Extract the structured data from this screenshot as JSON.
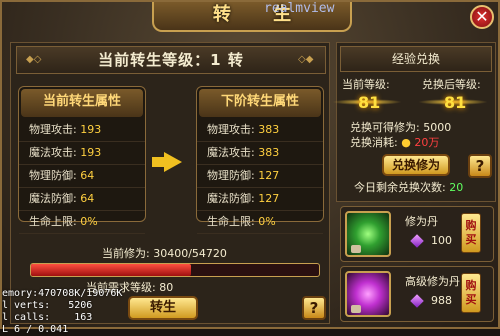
{
  "window": {
    "title": "转 生",
    "watermark": "realmview",
    "close_label": "✕"
  },
  "level_header": "当前转生等级：1 转",
  "current_attrs": {
    "title": "当前转生属性",
    "rows": [
      {
        "name": "物理攻击:",
        "value": "193"
      },
      {
        "name": "魔法攻击:",
        "value": "193"
      },
      {
        "name": "物理防御:",
        "value": "64"
      },
      {
        "name": "魔法防御:",
        "value": "64"
      },
      {
        "name": "生命上限:",
        "value": "0%"
      }
    ]
  },
  "next_attrs": {
    "title": "下阶转生属性",
    "rows": [
      {
        "name": "物理攻击:",
        "value": "383"
      },
      {
        "name": "魔法攻击:",
        "value": "383"
      },
      {
        "name": "物理防御:",
        "value": "127"
      },
      {
        "name": "魔法防御:",
        "value": "127"
      },
      {
        "name": "生命上限:",
        "value": "0%"
      }
    ]
  },
  "cultivation": {
    "text": "当前修为: 30400/54720",
    "progress": 0.5556
  },
  "requirement": "当前需求等级: 80",
  "rebirth_button": "转生",
  "help_label": "?",
  "debug": {
    "memory": "emory:470708K/19076K",
    "verts": "l verts:   5206",
    "calls": "l calls:    163",
    "fps": "L 6 / 0.041"
  },
  "exchange": {
    "title": "经验兑换",
    "current_level_label": "当前等级:",
    "after_level_label": "兑换后等级:",
    "current_level": "81",
    "after_level": "81",
    "gain_label": "兑换可得修为:",
    "gain_value": "5000",
    "cost_label": "兑换消耗:",
    "cost_value": "20万",
    "button": "兑换修为",
    "remaining_label": "今日剩余兑换次数:",
    "remaining_value": "20"
  },
  "items": [
    {
      "name": "修为丹",
      "price": "100",
      "buy": "购买",
      "icon": "green-orb-icon",
      "color": "#30c040"
    },
    {
      "name": "高级修为丹",
      "price": "988",
      "buy": "购买",
      "icon": "purple-orb-icon",
      "color": "#c030d0"
    }
  ]
}
